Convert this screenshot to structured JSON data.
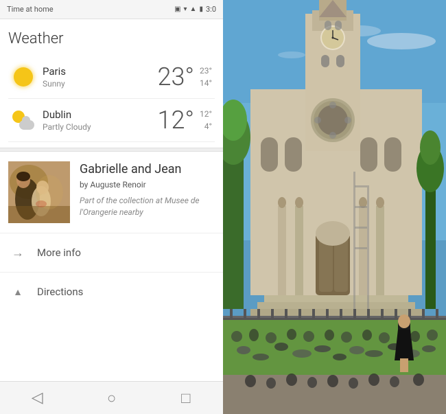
{
  "statusBar": {
    "title": "Time at home",
    "time": "3:0",
    "icons": [
      "vibrate",
      "wifi",
      "signal",
      "battery"
    ]
  },
  "weather": {
    "title": "Weather",
    "cities": [
      {
        "name": "Paris",
        "condition": "Sunny",
        "icon": "sun",
        "tempMain": "23°",
        "tempHigh": "23°",
        "tempLow": "14°"
      },
      {
        "name": "Dublin",
        "condition": "Partly Cloudy",
        "icon": "partly-cloudy",
        "tempMain": "12°",
        "tempHigh": "12°",
        "tempLow": "4°"
      }
    ]
  },
  "artCard": {
    "title": "Gabrielle and Jean",
    "artist": "by Auguste Renoir",
    "description": "Part of the collection at Musee de l'Orangerie nearby"
  },
  "actions": [
    {
      "id": "more-info",
      "label": "More info",
      "icon": "→"
    },
    {
      "id": "directions",
      "label": "Directions",
      "icon": "▲"
    }
  ],
  "bottomNav": {
    "buttons": [
      "◁",
      "○",
      "□"
    ]
  }
}
